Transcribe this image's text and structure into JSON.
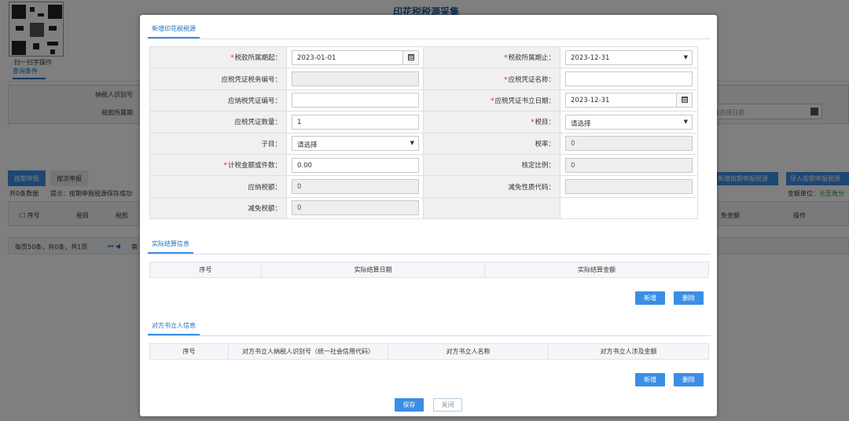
{
  "background": {
    "page_title": "印花税税源采集",
    "qr_label": "扫一扫字操作",
    "query_tab": "查询条件",
    "form_labels": [
      "纳税人识别号",
      "税款所属期"
    ],
    "date_placeholder": "请选择日期",
    "tabs": [
      "按期申报",
      "按次申报"
    ],
    "record_count": "共0条数据",
    "hint": "提示：按期申报税源保存成功",
    "buttons": [
      "新增按期申报税源",
      "导入按期申报税源"
    ],
    "unit_label": "金额单位：",
    "unit_value": "元至角分",
    "table_headers": [
      "序号",
      "税目",
      "税款",
      "免金额",
      "操作"
    ],
    "pager_text": "每页50条，共0条，共1页",
    "pager_nav": "第"
  },
  "modal": {
    "section_title": "新增印花税税源",
    "fields": {
      "period_start": {
        "label": "税款所属期起：",
        "value": "2023-01-01",
        "required": "*"
      },
      "period_end": {
        "label": "税款所属期止：",
        "value": "2023-12-31",
        "required": "*"
      },
      "voucher_tax_no": {
        "label": "应税凭证税务编号：",
        "value": ""
      },
      "voucher_name": {
        "label": "应税凭证名称：",
        "value": "",
        "required": "*"
      },
      "voucher_no": {
        "label": "应纳税凭证编号：",
        "value": ""
      },
      "voucher_date": {
        "label": "应税凭证书立日期：",
        "value": "2023-12-31",
        "required": "*"
      },
      "voucher_qty": {
        "label": "应税凭证数量：",
        "value": "1"
      },
      "tax_item": {
        "label": "税目：",
        "value": "请选择",
        "required": "*"
      },
      "sub_item": {
        "label": "子目：",
        "value": "请选择"
      },
      "tax_rate": {
        "label": "税率：",
        "value": "0"
      },
      "tax_basis": {
        "label": "计税金额或件数：",
        "value": "0.00",
        "required": "*"
      },
      "approved_ratio": {
        "label": "核定比例：",
        "value": "0"
      },
      "tax_payable": {
        "label": "应纳税额：",
        "value": "0"
      },
      "relief_code": {
        "label": "减免性质代码：",
        "value": ""
      },
      "tax_relief": {
        "label": "减免税额：",
        "value": "0"
      }
    },
    "settlement": {
      "title": "实际结算信息",
      "columns": [
        "序号",
        "实际结算日期",
        "实际结算金额"
      ],
      "add_label": "新增",
      "delete_label": "删除"
    },
    "counterparty": {
      "title": "对方书立人信息",
      "columns": [
        "序号",
        "对方书立人纳税人识别号（统一社会信用代码）",
        "对方书立人名称",
        "对方书立人涉及金额"
      ],
      "add_label": "新增",
      "delete_label": "删除"
    },
    "save_label": "保存",
    "close_label": "关闭"
  },
  "colors": {
    "accent": "#3a8ee6",
    "required": "#e02020",
    "link": "#1f6fb8"
  }
}
